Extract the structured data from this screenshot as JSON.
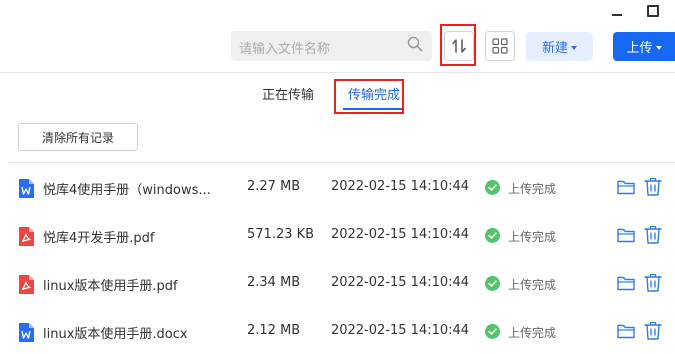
{
  "search": {
    "placeholder": "请输入文件名称"
  },
  "toolbar": {
    "new_label": "新建",
    "upload_label": "上传"
  },
  "tabs": [
    {
      "label": "正在传输",
      "active": false
    },
    {
      "label": "传输完成",
      "active": true
    }
  ],
  "clear_label": "清除所有记录",
  "files": [
    {
      "name": "悦库4使用手册（windows...",
      "type": "word",
      "size": "2.27 MB",
      "time": "2022-02-15 14:10:44",
      "status": "上传完成"
    },
    {
      "name": "悦库4开发手册.pdf",
      "type": "pdf",
      "size": "571.23 KB",
      "time": "2022-02-15 14:10:44",
      "status": "上传完成"
    },
    {
      "name": "linux版本使用手册.pdf",
      "type": "pdf",
      "size": "2.34 MB",
      "time": "2022-02-15 14:10:44",
      "status": "上传完成"
    },
    {
      "name": "linux版本使用手册.docx",
      "type": "word",
      "size": "2.12 MB",
      "time": "2022-02-15 14:10:44",
      "status": "上传完成"
    }
  ],
  "colors": {
    "accent": "#1668f0",
    "success": "#52c469",
    "highlight": "#e8231e",
    "word": "#2b6df0",
    "pdf": "#e8483f",
    "action": "#2e7de0"
  }
}
